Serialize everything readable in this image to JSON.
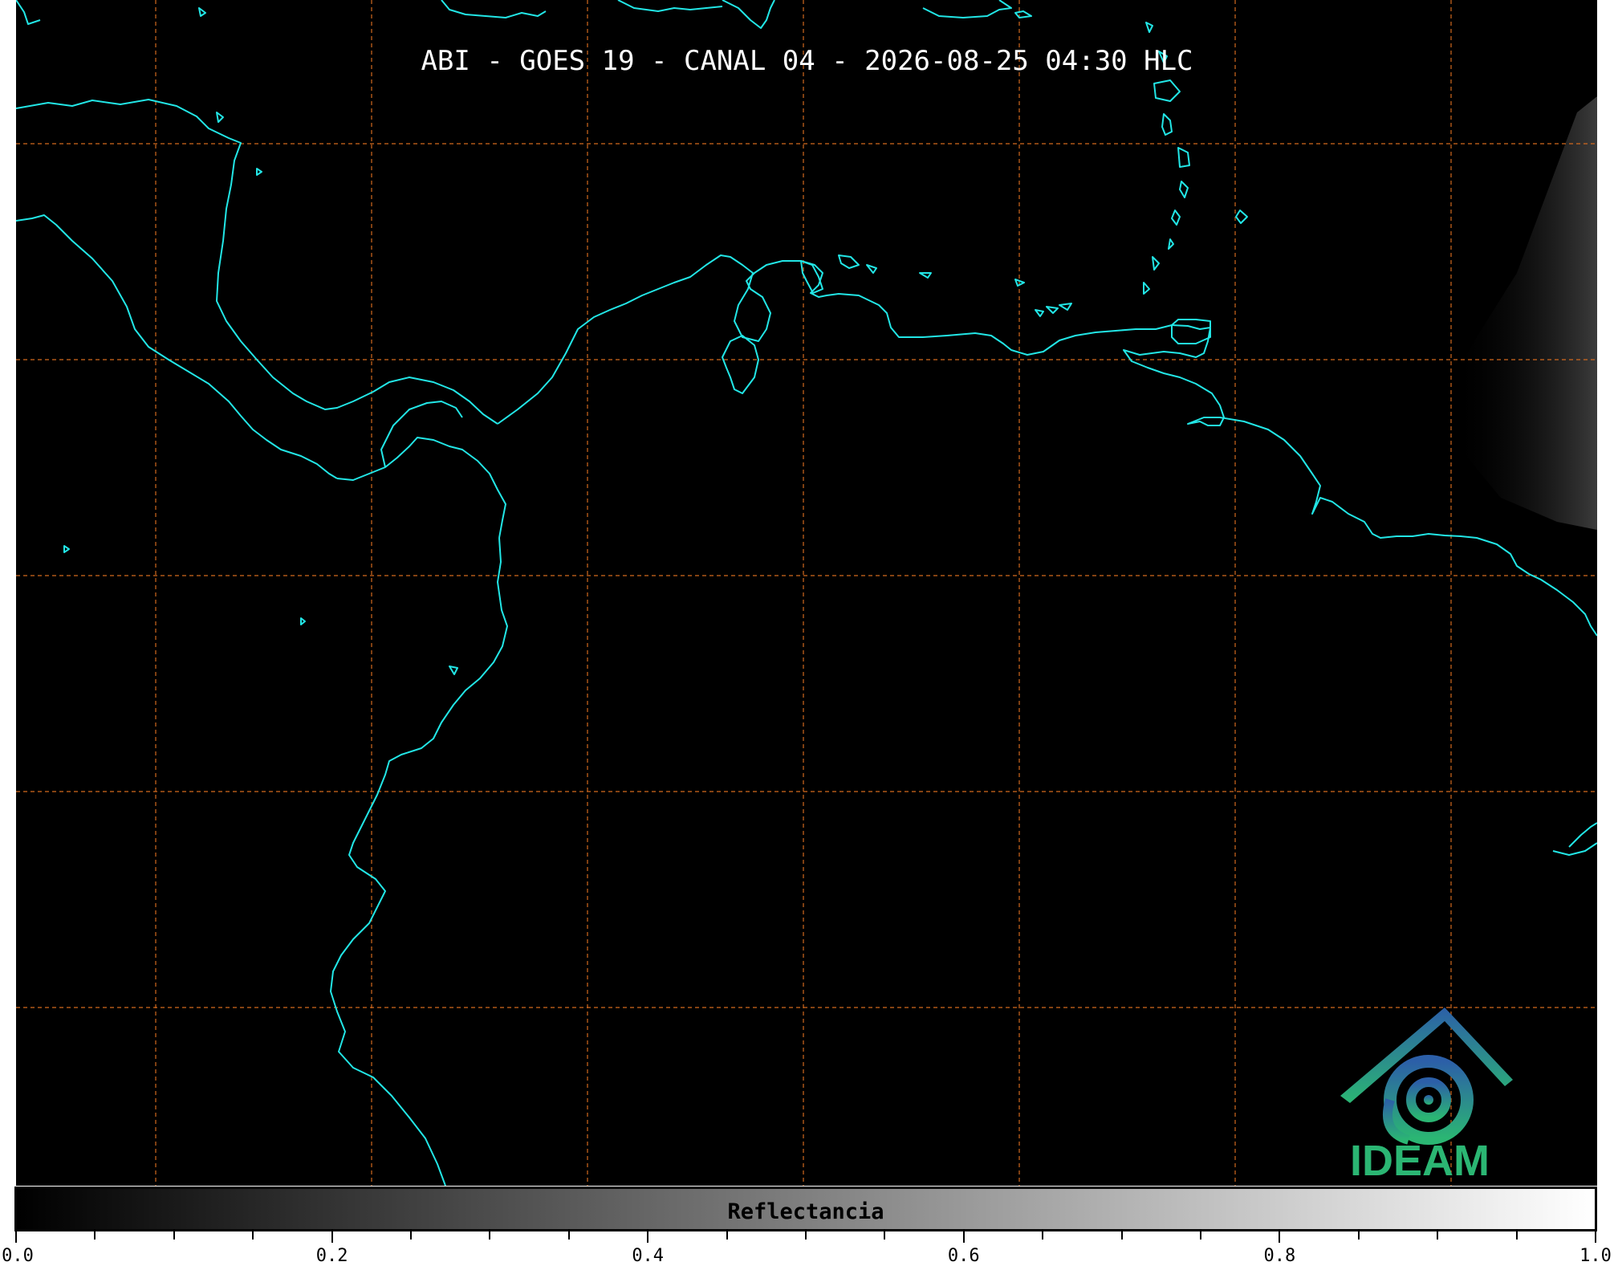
{
  "title": "ABI - GOES 19 - CANAL 04 - 2026-08-25 04:30 HLC",
  "logo": {
    "text": "IDEAM",
    "icon": "ideam-logo-icon"
  },
  "colorbar": {
    "label": "Reflectancia",
    "min": 0.0,
    "max": 1.0,
    "tick_labels": [
      "0.0",
      "0.2",
      "0.4",
      "0.6",
      "0.8",
      "1.0"
    ],
    "gradient_start": "#000000",
    "gradient_end": "#ffffff"
  },
  "colors": {
    "coastline": "#22e6e6",
    "gridlines": "#d2691e",
    "background": "#000000"
  },
  "gridlines": {
    "style": "dashed"
  }
}
